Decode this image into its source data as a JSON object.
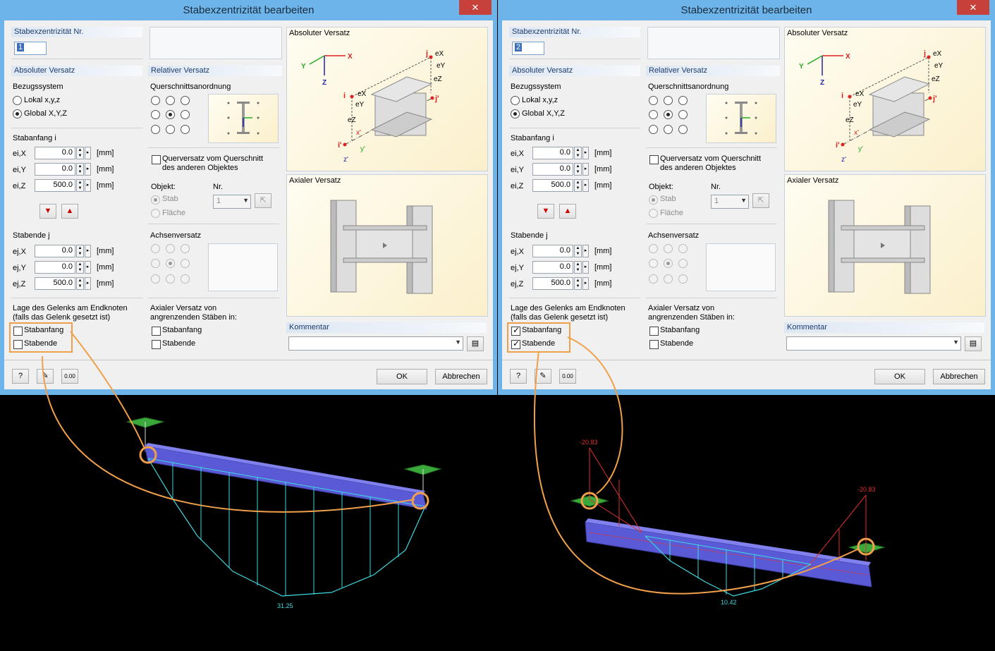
{
  "dialogs": [
    {
      "title": "Stabexzentrizität bearbeiten",
      "close": "✕",
      "nr_label": "Stabexzentrizität Nr.",
      "nr_value": "1",
      "absoluter_versatz": "Absoluter Versatz",
      "bezugssystem": "Bezugssystem",
      "lokal": "Lokal x,y,z",
      "global": "Global X,Y,Z",
      "stabanfang_i": "Stabanfang i",
      "stabende_j": "Stabende j",
      "eix": "ei,X",
      "eiy": "ei,Y",
      "eiz": "ei,Z",
      "ejx": "ej,X",
      "ejy": "ej,Y",
      "ejz": "ej,Z",
      "eix_val": "0.0",
      "eiy_val": "0.0",
      "eiz_val": "500.0",
      "ejx_val": "0.0",
      "ejy_val": "0.0",
      "ejz_val": "500.0",
      "unit": "[mm]",
      "gelenk_line1": "Lage des Gelenks am Endknoten",
      "gelenk_line2": "(falls das Gelenk gesetzt ist)",
      "gelenk_anfang": "Stabanfang",
      "gelenk_ende": "Stabende",
      "gelenk_anfang_checked": false,
      "gelenk_ende_checked": false,
      "relativer_versatz": "Relativer Versatz",
      "querschnittsanordnung": "Querschnittsanordnung",
      "querversatz1": "Querversatz vom Querschnitt",
      "querversatz2": "des anderen Objektes",
      "objekt": "Objekt:",
      "nr": "Nr.",
      "stab": "Stab",
      "flaeche": "Fläche",
      "objekt_nr": "1",
      "achsenversatz": "Achsenversatz",
      "axial1": "Axialer Versatz von",
      "axial2": "angrenzenden Stäben in:",
      "axial_anfang": "Stabanfang",
      "axial_ende": "Stabende",
      "pic_abs": "Absoluter Versatz",
      "pic_axial": "Axialer Versatz",
      "kommentar": "Kommentar",
      "ok": "OK",
      "abbrechen": "Abbrechen"
    },
    {
      "title": "Stabexzentrizität bearbeiten",
      "close": "✕",
      "nr_label": "Stabexzentrizität Nr.",
      "nr_value": "2",
      "absoluter_versatz": "Absoluter Versatz",
      "bezugssystem": "Bezugssystem",
      "lokal": "Lokal x,y,z",
      "global": "Global X,Y,Z",
      "stabanfang_i": "Stabanfang i",
      "stabende_j": "Stabende j",
      "eix": "ei,X",
      "eiy": "ei,Y",
      "eiz": "ei,Z",
      "ejx": "ej,X",
      "ejy": "ej,Y",
      "ejz": "ej,Z",
      "eix_val": "0.0",
      "eiy_val": "0.0",
      "eiz_val": "500.0",
      "ejx_val": "0.0",
      "ejy_val": "0.0",
      "ejz_val": "500.0",
      "unit": "[mm]",
      "gelenk_line1": "Lage des Gelenks am Endknoten",
      "gelenk_line2": "(falls das Gelenk gesetzt ist)",
      "gelenk_anfang": "Stabanfang",
      "gelenk_ende": "Stabende",
      "gelenk_anfang_checked": true,
      "gelenk_ende_checked": true,
      "relativer_versatz": "Relativer Versatz",
      "querschnittsanordnung": "Querschnittsanordnung",
      "querversatz1": "Querversatz vom Querschnitt",
      "querversatz2": "des anderen Objektes",
      "objekt": "Objekt:",
      "nr": "Nr.",
      "stab": "Stab",
      "flaeche": "Fläche",
      "objekt_nr": "1",
      "achsenversatz": "Achsenversatz",
      "axial1": "Axialer Versatz von",
      "axial2": "angrenzenden Stäben in:",
      "axial_anfang": "Stabanfang",
      "axial_ende": "Stabende",
      "pic_abs": "Absoluter Versatz",
      "pic_axial": "Axialer Versatz",
      "kommentar": "Kommentar",
      "ok": "OK",
      "abbrechen": "Abbrechen"
    }
  ],
  "diagram_labels": {
    "x": "X",
    "y": "Y",
    "z": "Z",
    "i": "i",
    "j": "j",
    "ip": "i'",
    "jp": "j'",
    "ex": "eX",
    "ey": "eY",
    "ez": "eZ",
    "xp": "x'",
    "yp": "y'",
    "zp": "z'"
  },
  "viewport_left": {
    "moment_value": "31.25"
  },
  "viewport_right": {
    "moment_value": "10.42",
    "end_moment_left": "-20.83",
    "end_moment_right": "-20.83"
  },
  "colors": {
    "highlight": "#f0a04b",
    "beam": "#5a5ad6",
    "moment": "#3fd8e0",
    "support": "#2a9a2a"
  }
}
